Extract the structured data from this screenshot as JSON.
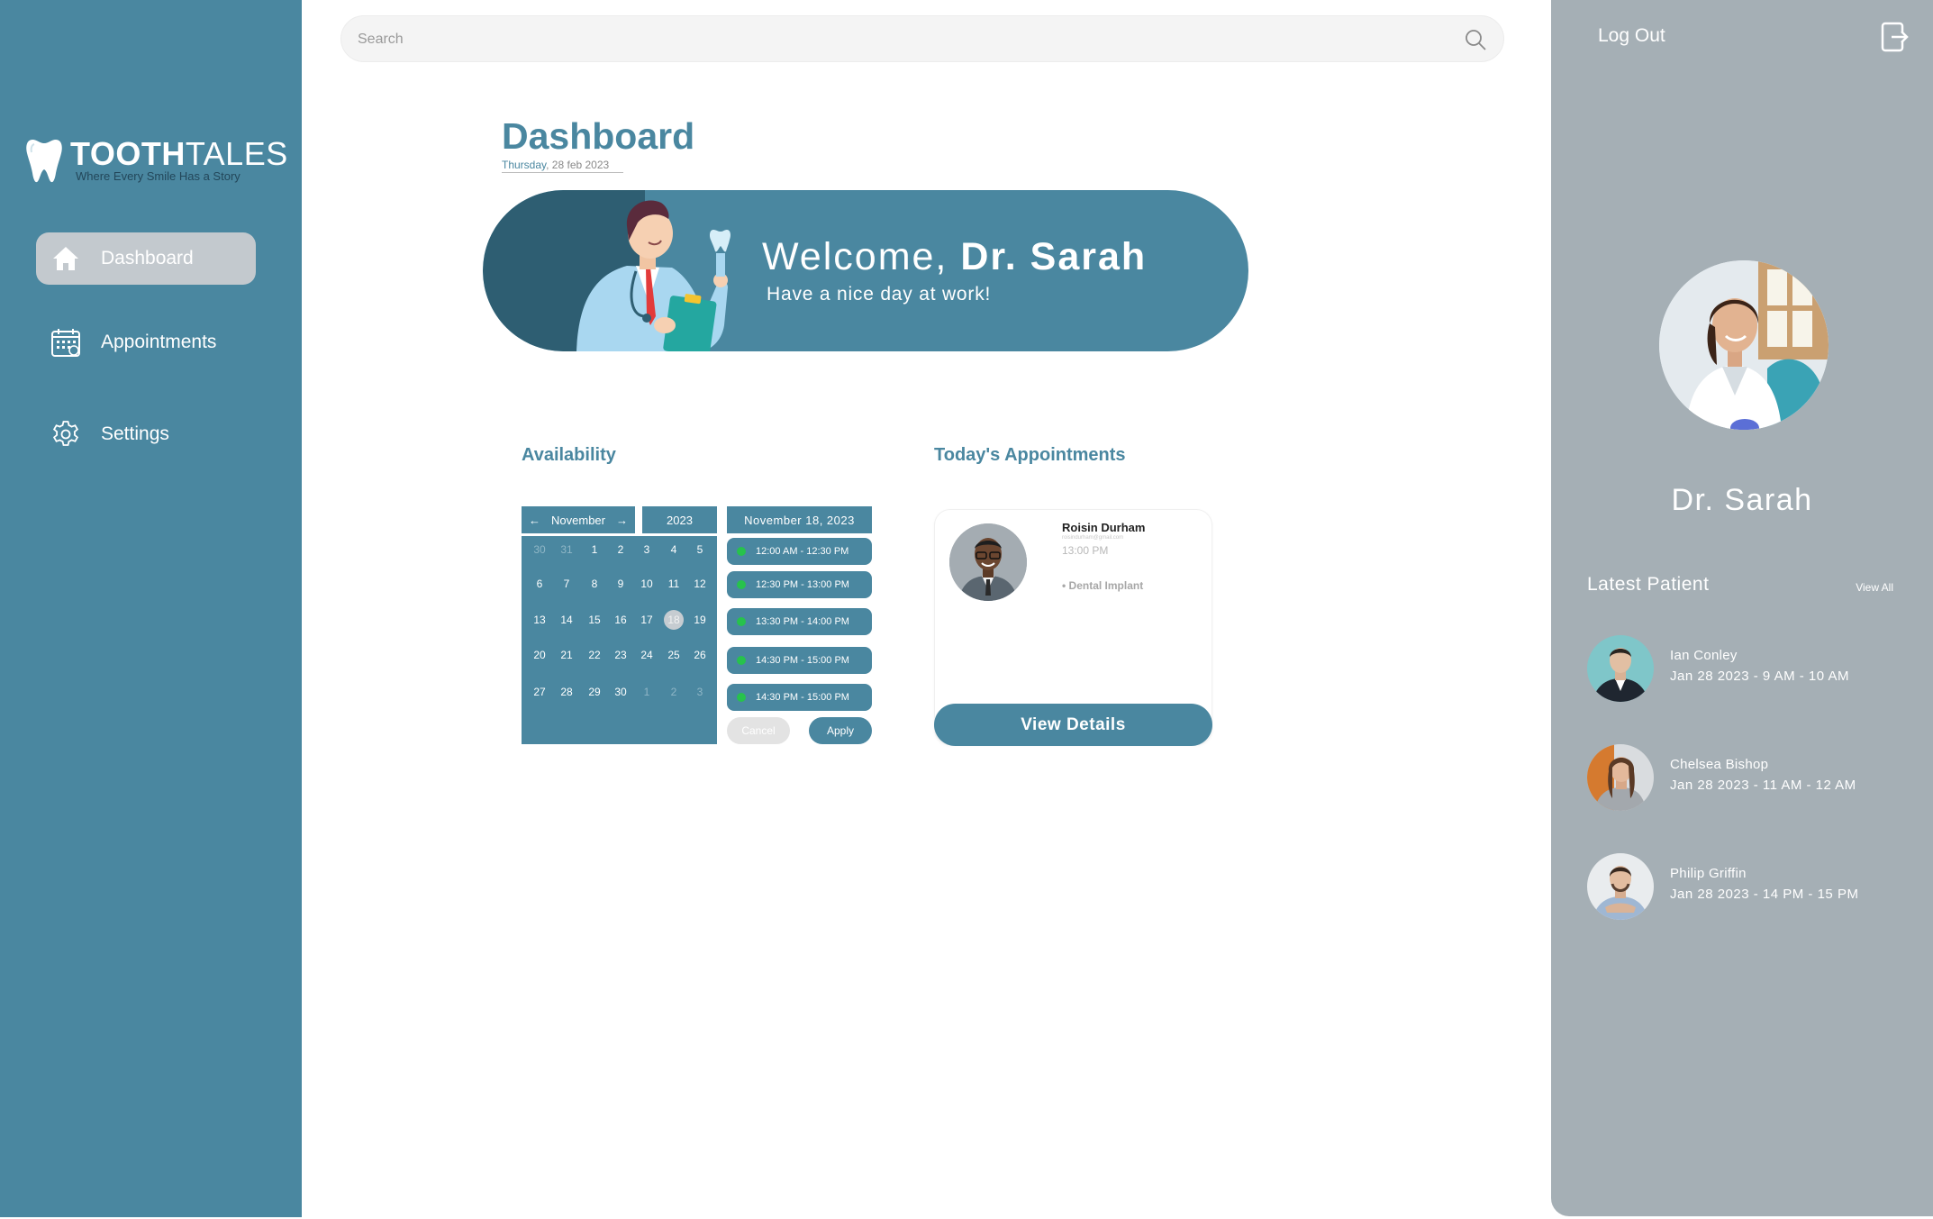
{
  "brand": {
    "name_bold": "TOOTH",
    "name_light": "TALES",
    "tagline": "Where Every Smile Has a Story"
  },
  "sidebar": {
    "items": [
      {
        "label": "Dashboard",
        "icon": "home-icon",
        "active": true
      },
      {
        "label": "Appointments",
        "icon": "calendar-icon",
        "active": false
      },
      {
        "label": "Settings",
        "icon": "gear-icon",
        "active": false
      }
    ]
  },
  "search": {
    "placeholder": "Search",
    "icon": "search-icon"
  },
  "header": {
    "title": "Dashboard",
    "day": "Thursday",
    "date": ", 28 feb 2023"
  },
  "banner": {
    "greeting": "Welcome,",
    "doctor": "Dr. Sarah",
    "subtitle": "Have a nice day at work!"
  },
  "availability": {
    "heading": "Availability",
    "month": "November",
    "year": "2023",
    "selected_date": "November 18, 2023",
    "prev_arrow": "←",
    "next_arrow": "→",
    "weeks": [
      [
        {
          "d": "30",
          "m": true
        },
        {
          "d": "31",
          "m": true
        },
        {
          "d": "1"
        },
        {
          "d": "2"
        },
        {
          "d": "3"
        },
        {
          "d": "4"
        },
        {
          "d": "5"
        }
      ],
      [
        {
          "d": "6"
        },
        {
          "d": "7"
        },
        {
          "d": "8"
        },
        {
          "d": "9"
        },
        {
          "d": "10"
        },
        {
          "d": "11"
        },
        {
          "d": "12"
        }
      ],
      [
        {
          "d": "13"
        },
        {
          "d": "14"
        },
        {
          "d": "15"
        },
        {
          "d": "16"
        },
        {
          "d": "17"
        },
        {
          "d": "18",
          "s": true
        },
        {
          "d": "19"
        }
      ],
      [
        {
          "d": "20"
        },
        {
          "d": "21"
        },
        {
          "d": "22"
        },
        {
          "d": "23"
        },
        {
          "d": "24"
        },
        {
          "d": "25"
        },
        {
          "d": "26"
        }
      ],
      [
        {
          "d": "27"
        },
        {
          "d": "28"
        },
        {
          "d": "29"
        },
        {
          "d": "30"
        },
        {
          "d": "1",
          "m": true
        },
        {
          "d": "2",
          "m": true
        },
        {
          "d": "3",
          "m": true
        }
      ]
    ],
    "slots": [
      "12:00 AM - 12:30 PM",
      "12:30 PM - 13:00 PM",
      "13:30 PM - 14:00 PM",
      "14:30 PM - 15:00 PM",
      "14:30 PM - 15:00 PM"
    ],
    "cancel_label": "Cancel",
    "apply_label": "Apply"
  },
  "appointments": {
    "heading": "Today's Appointments",
    "card": {
      "name": "Roisin Durham",
      "email": "roisindurham@gmail.com",
      "time": "13:00 PM",
      "treatment": "• Dental Implant"
    },
    "view_details_label": "View Details"
  },
  "right_panel": {
    "logout_label": "Log Out",
    "profile_name": "Dr. Sarah",
    "latest_heading": "Latest Patient",
    "view_all_label": "View All",
    "patients": [
      {
        "name": "Ian Conley",
        "time": "Jan 28 2023 - 9 AM - 10 AM"
      },
      {
        "name": "Chelsea Bishop",
        "time": "Jan 28 2023 - 11 AM - 12 AM"
      },
      {
        "name": "Philip Griffin",
        "time": "Jan 28 2023 - 14 PM - 15 PM"
      }
    ]
  },
  "colors": {
    "primary": "#4a87a0",
    "dark_primary": "#2e5e72",
    "panel": "#a5afb5",
    "active_nav": "#c3c9ce",
    "slot_dot": "#27c24c"
  }
}
